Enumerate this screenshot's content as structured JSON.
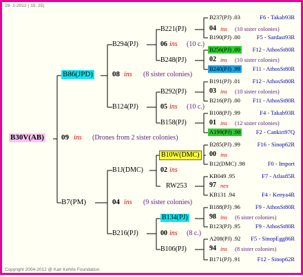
{
  "header": {
    "date": "29- 1-2012 ( 15: 25)"
  },
  "footer": {
    "copyright": "Copyright 2004-2012 @ Karl Kehrle Foundation."
  },
  "root": {
    "label": "B30V(AB)",
    "year": "09",
    "note": "ins",
    "desc": "(Drones from 2 sister colonies)"
  },
  "gen1": {
    "upper": {
      "label": "B86(JPD)",
      "year": "08",
      "note": "ins",
      "desc": "(8 sister colonies)"
    },
    "lower": {
      "label": "B7(PM)",
      "year": "04",
      "note": "ins",
      "desc": "(9 sister colonies)"
    }
  },
  "gen2": {
    "a": {
      "label": "B294(PJ)",
      "year": "06",
      "note": "ins",
      "desc": "(10 c.)"
    },
    "b": {
      "label": "B124(PJ)",
      "year": "05",
      "note": "ins",
      "desc": "(10 c.)"
    },
    "c": {
      "label": "B1J(DMC)",
      "year": "02",
      "note": "ins"
    },
    "d": {
      "label": "B216(PJ)",
      "year": "00",
      "note": "ins",
      "desc": "(8 c.)"
    }
  },
  "gen3": {
    "a1": "B221(PJ)",
    "a2": "B248(PJ)",
    "b1": "B292(PJ)",
    "b2": "B158(PJ)",
    "c1": "B10W(DMC)",
    "c2": "RW253",
    "d1": "B134(PJ)",
    "d2": "B106(PJ)"
  },
  "gen4": [
    {
      "label": "B237(PJ) .03",
      "origin": "F6 - Takab93R"
    },
    {
      "year": "04",
      "note": "ins",
      "desc": "(10 sister colonies)"
    },
    {
      "label": "B190(PJ) .00",
      "origin": "F5 - Sardast93R"
    },
    {
      "label": "B256(PJ) .00",
      "origin": "F12 - AthosSt80R"
    },
    {
      "year": "02",
      "note": "ins",
      "desc": "(10 sister colonies)"
    },
    {
      "label": "B240(PJ) .99",
      "origin": "F11 - AthosSt80R"
    },
    {
      "label": "B191(PJ) .01",
      "origin": "F12 - AthosSt80R"
    },
    {
      "year": "03",
      "note": "ins",
      "desc": "(10 sister colonies)"
    },
    {
      "label": "B216(PJ) .00",
      "origin": "F11 - AthosSt80R"
    },
    {
      "label": "B108(PJ) .99",
      "origin": "F4 - Takab93R"
    },
    {
      "year": "01",
      "note": "ins",
      "desc": "(12 sister colonies)"
    },
    {
      "label": "A199(PJ) .98",
      "origin": "F2 - Cankiri97Q"
    },
    {
      "label": "B285(PJ) .99",
      "origin": "F16 - Sinop62R"
    },
    {
      "year": "00",
      "note": "ins"
    },
    {
      "label": "B12(DMC) .98",
      "origin": "F0 - Import"
    },
    {
      "label": "KB049 .95",
      "origin": "F7 - Atlas85R"
    },
    {
      "year": "97",
      "note": "nex"
    },
    {
      "label": "KB131 .94",
      "origin": "F4 - Kenya4R"
    },
    {
      "label": "B188(PJ) .96",
      "origin": "F9 - AthosSt80R"
    },
    {
      "year": "98",
      "note": "ins",
      "desc": "(6 sister colonies)"
    },
    {
      "label": "B123(PJ) .95",
      "origin": "F9 - AthosSt80R"
    },
    {
      "label": "A208(PJ) .92",
      "origin": "F5 - SinopEgg86R"
    },
    {
      "year": "94",
      "note": "ins",
      "desc": "(8 sister colonies)"
    },
    {
      "label": "B171(PJ) .91",
      "origin": "F12 - Sinop62R"
    }
  ],
  "colors": {
    "border": "#e8009a",
    "cyan": "#14e4f0",
    "yellow": "#ffff30",
    "green": "#2ecc2e",
    "blue": "#1aa4e8",
    "ins": "#d40000",
    "text_blue": "#1a2fa8"
  }
}
